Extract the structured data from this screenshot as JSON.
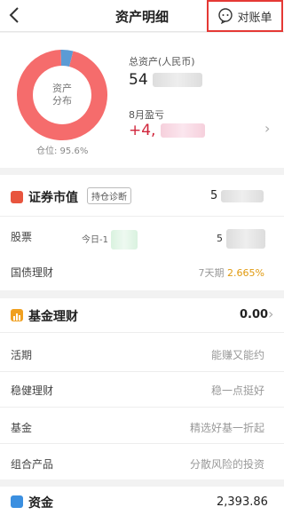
{
  "header": {
    "back_icon": "chevron-left-icon",
    "title": "资产明细",
    "statement_label": "对账单",
    "statement_icon": "chat-service-icon"
  },
  "overview": {
    "donut_label_line1": "资产",
    "donut_label_line2": "分布",
    "position_ratio": "仓位: 95.6%",
    "donut_segments": [
      {
        "share": 0.956,
        "color": "#f56c6c"
      },
      {
        "share": 0.044,
        "color": "#5b9bd5"
      }
    ],
    "total_label": "总资产(人民币)",
    "total_value_prefix": "54",
    "monthly_label": "8月盈亏",
    "monthly_value_prefix": "+4,"
  },
  "securities": {
    "title": "证券市值",
    "diagnose_button": "持仓诊断",
    "value_prefix": "5",
    "stocks_label": "股票",
    "today_label": "今日-1",
    "stocks_value_prefix": "5",
    "bond_label": "国债理财",
    "bond_term": "7天期",
    "bond_rate": "2.665%"
  },
  "funds": {
    "title": "基金理财",
    "value": "0.00",
    "items": [
      {
        "label": "活期",
        "desc": "能赚又能约"
      },
      {
        "label": "稳健理财",
        "desc": "稳一点挺好"
      },
      {
        "label": "基金",
        "desc": "精选好基一折起"
      },
      {
        "label": "组合产品",
        "desc": "分散风险的投资"
      }
    ]
  },
  "cash": {
    "title": "资金",
    "value": "2,393.86"
  },
  "colors": {
    "accent_red": "#e53935",
    "loss_red": "#d0243a",
    "rate_orange": "#f0a020"
  }
}
